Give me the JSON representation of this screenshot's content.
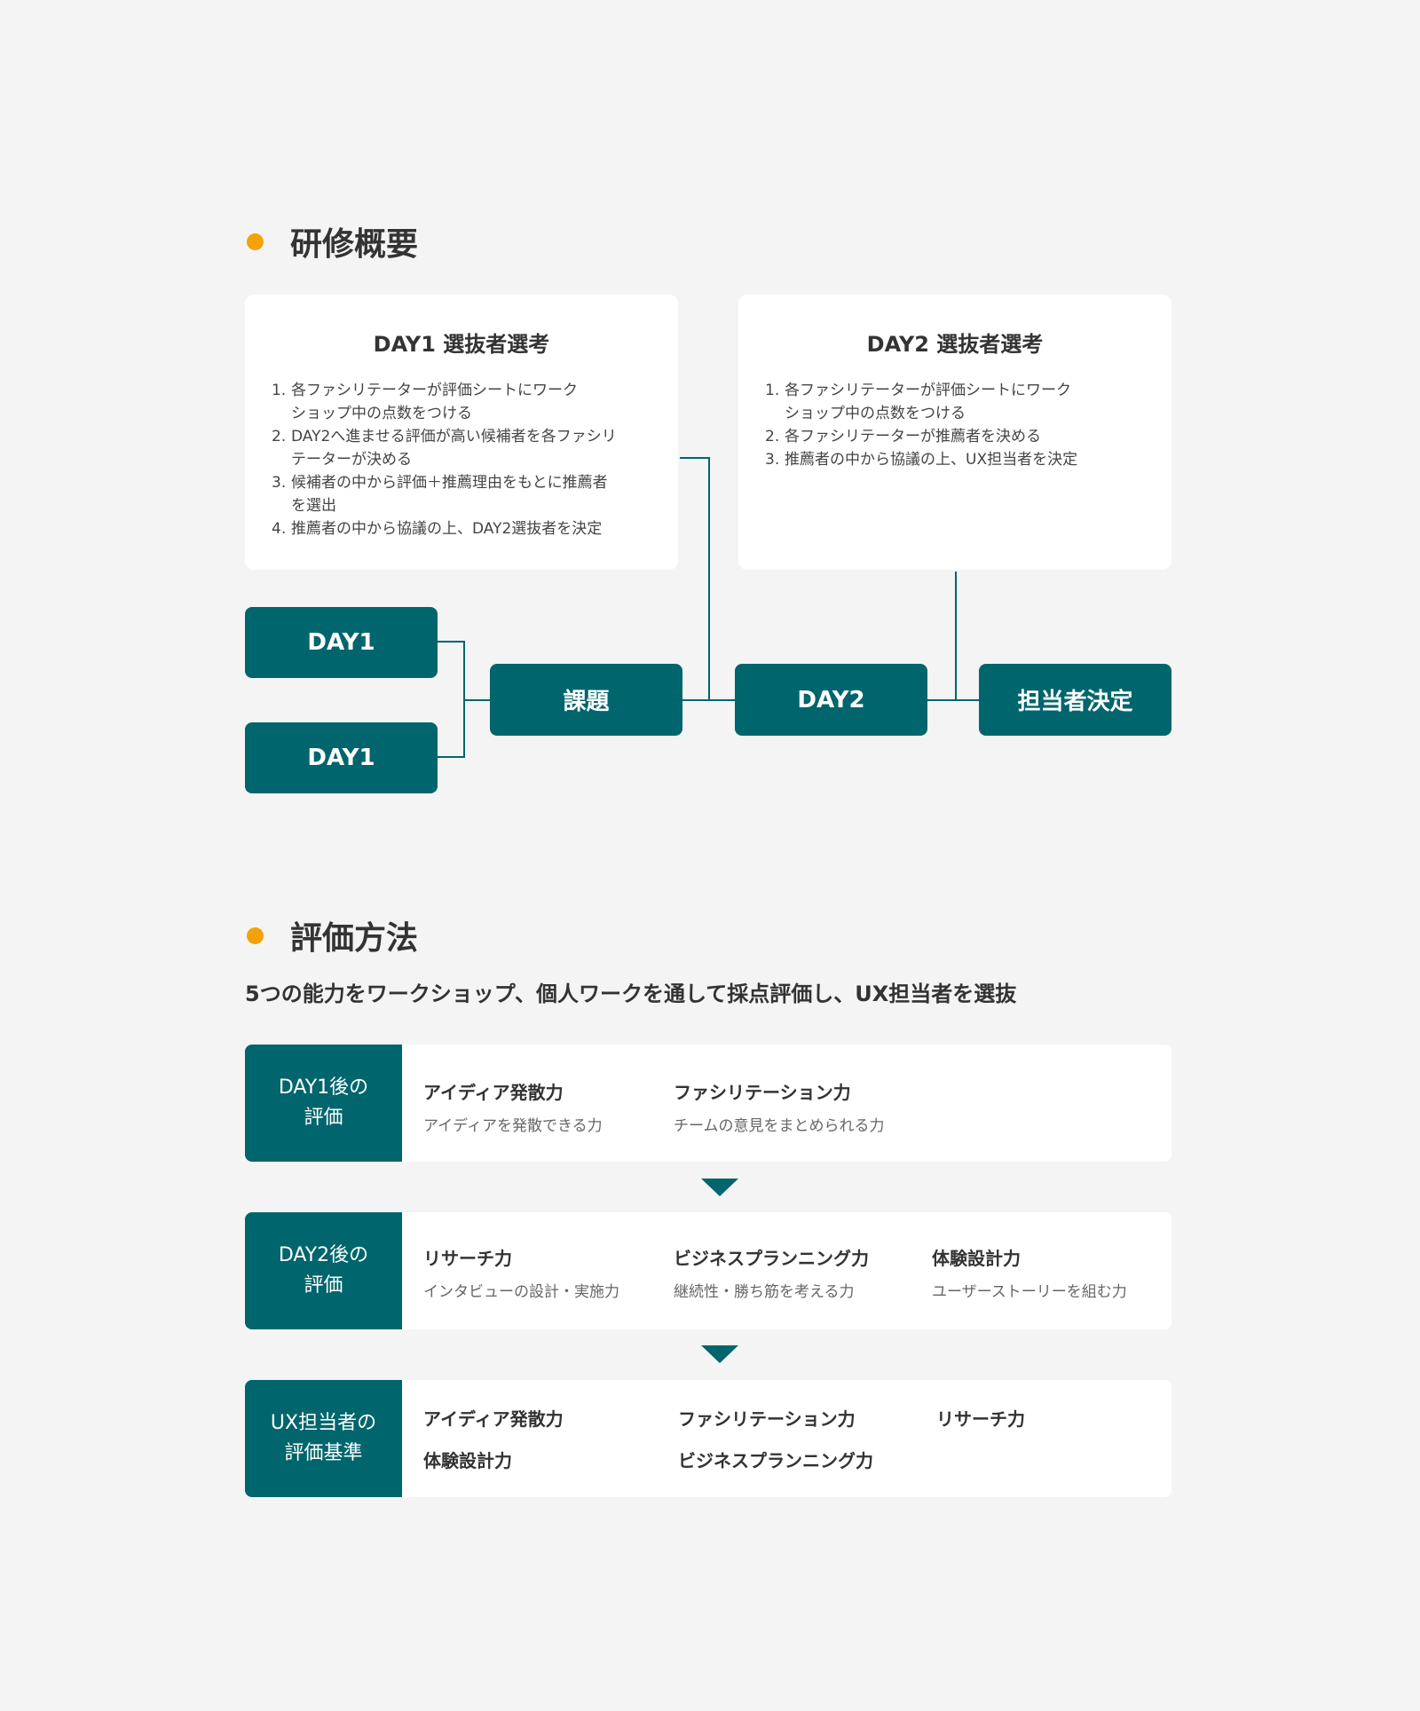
{
  "colors": {
    "teal": "#00656c",
    "accent": "#f4a20a",
    "background": "#f4f4f4"
  },
  "overview": {
    "title": "研修概要",
    "day1_card": {
      "title": "DAY1 選抜者選考",
      "items": [
        {
          "num": "1.",
          "lines": [
            "各ファシリテーターが評価シートにワーク",
            "ショップ中の点数をつける"
          ]
        },
        {
          "num": "2.",
          "lines": [
            "DAY2へ進ませる評価が高い候補者を各ファシリ",
            "テーターが決める"
          ]
        },
        {
          "num": "3.",
          "lines": [
            "候補者の中から評価＋推薦理由をもとに推薦者",
            "を選出"
          ]
        },
        {
          "num": "4.",
          "lines": [
            "推薦者の中から協議の上、DAY2選抜者を決定"
          ]
        }
      ]
    },
    "day2_card": {
      "title": "DAY2 選抜者選考",
      "items": [
        {
          "num": "1.",
          "lines": [
            "各ファシリテーターが評価シートにワーク",
            "ショップ中の点数をつける"
          ]
        },
        {
          "num": "2.",
          "lines": [
            "各ファシリテーターが推薦者を決める"
          ]
        },
        {
          "num": "3.",
          "lines": [
            "推薦者の中から協議の上、UX担当者を決定"
          ]
        }
      ]
    },
    "flow": {
      "day1_a": "DAY1",
      "day1_b": "DAY1",
      "task": "課題",
      "day2": "DAY2",
      "decision": "担当者決定"
    }
  },
  "evaluation": {
    "title": "評価方法",
    "subtitle": "5つの能力をワークショップ、個人ワークを通して採点評価し、UX担当者を選抜",
    "rows": [
      {
        "label_lines": [
          "DAY1後の",
          "評価"
        ],
        "abilities": [
          {
            "name": "アイディア発散力",
            "desc": "アイディアを発散できる力"
          },
          {
            "name": "ファシリテーション力",
            "desc": "チームの意見をまとめられる力"
          }
        ]
      },
      {
        "label_lines": [
          "DAY2後の",
          "評価"
        ],
        "abilities": [
          {
            "name": "リサーチ力",
            "desc": "インタビューの設計・実施力"
          },
          {
            "name": "ビジネスプランニング力",
            "desc": "継続性・勝ち筋を考える力"
          },
          {
            "name": "体験設計力",
            "desc": "ユーザーストーリーを組む力"
          }
        ]
      }
    ],
    "standard": {
      "label_lines": [
        "UX担当者の",
        "評価基準"
      ],
      "items": [
        "アイディア発散力",
        "ファシリテーション力",
        "リサーチ力",
        "体験設計力",
        "ビジネスプランニング力"
      ]
    }
  }
}
